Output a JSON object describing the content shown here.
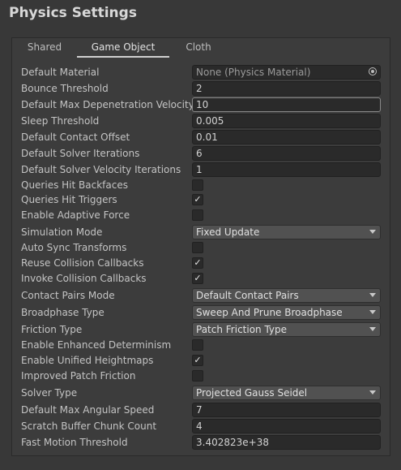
{
  "window": {
    "title": "Physics Settings"
  },
  "tabs": [
    {
      "label": "Shared"
    },
    {
      "label": "Game Object"
    },
    {
      "label": "Cloth"
    }
  ],
  "active_tab": "Game Object",
  "fields": {
    "default_material": {
      "label": "Default Material",
      "value": "None (Physics Material)"
    },
    "bounce_threshold": {
      "label": "Bounce Threshold",
      "value": "2"
    },
    "max_depenetration": {
      "label": "Default Max Depenetration Velocity",
      "value": "10"
    },
    "sleep_threshold": {
      "label": "Sleep Threshold",
      "value": "0.005"
    },
    "contact_offset": {
      "label": "Default Contact Offset",
      "value": "0.01"
    },
    "solver_iterations": {
      "label": "Default Solver Iterations",
      "value": "6"
    },
    "solver_velocity_iterations": {
      "label": "Default Solver Velocity Iterations",
      "value": "1"
    },
    "queries_hit_backfaces": {
      "label": "Queries Hit Backfaces",
      "checked": ""
    },
    "queries_hit_triggers": {
      "label": "Queries Hit Triggers",
      "checked": "✓"
    },
    "adaptive_force": {
      "label": "Enable Adaptive Force",
      "checked": ""
    },
    "simulation_mode": {
      "label": "Simulation Mode",
      "value": "Fixed Update"
    },
    "auto_sync": {
      "label": "Auto Sync Transforms",
      "checked": ""
    },
    "reuse_callbacks": {
      "label": "Reuse Collision Callbacks",
      "checked": "✓"
    },
    "invoke_callbacks": {
      "label": "Invoke Collision Callbacks",
      "checked": "✓"
    },
    "contact_pairs_mode": {
      "label": "Contact Pairs Mode",
      "value": "Default Contact Pairs"
    },
    "broadphase_type": {
      "label": "Broadphase Type",
      "value": "Sweep And Prune Broadphase"
    },
    "friction_type": {
      "label": "Friction Type",
      "value": "Patch Friction Type"
    },
    "enhanced_determinism": {
      "label": "Enable Enhanced Determinism",
      "checked": ""
    },
    "unified_heightmaps": {
      "label": "Enable Unified Heightmaps",
      "checked": "✓"
    },
    "improved_patch_friction": {
      "label": "Improved Patch Friction",
      "checked": ""
    },
    "solver_type": {
      "label": "Solver Type",
      "value": "Projected Gauss Seidel"
    },
    "max_angular_speed": {
      "label": "Default Max Angular Speed",
      "value": "7"
    },
    "scratch_buffer": {
      "label": "Scratch Buffer Chunk Count",
      "value": "4"
    },
    "fast_motion_threshold": {
      "label": "Fast Motion Threshold",
      "value": "3.402823e+38"
    }
  }
}
